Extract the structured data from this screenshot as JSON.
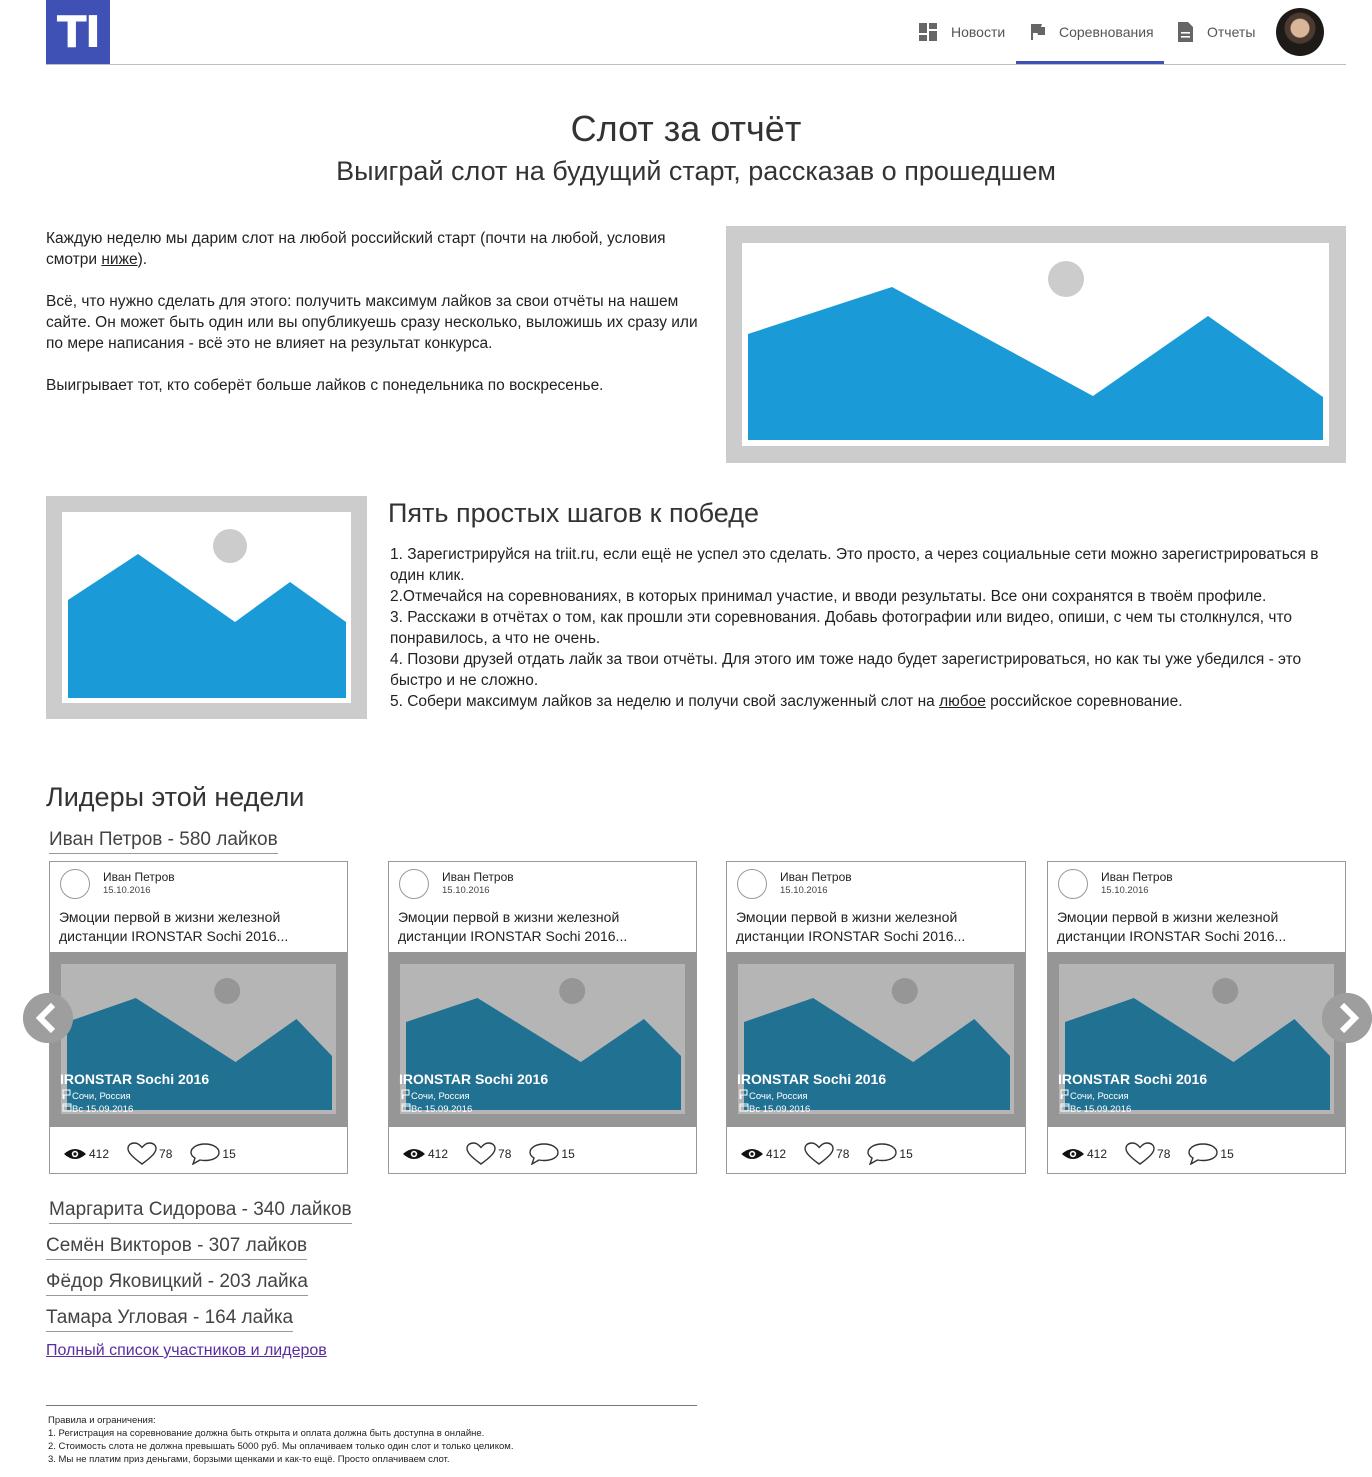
{
  "header": {
    "logo_text": "TI",
    "nav": [
      {
        "label": "Новости",
        "icon": "dashboard-icon"
      },
      {
        "label": "Соревнования",
        "icon": "flag-icon",
        "active": true
      },
      {
        "label": "Отчеты",
        "icon": "document-icon"
      }
    ],
    "accent_color": "#3f51b5"
  },
  "hero": {
    "title": "Слот за отчёт",
    "subtitle": "Выиграй слот на будущий старт, рассказав о прошедшем"
  },
  "intro": {
    "p1_before": "Каждую неделю мы дарим слот на любой российский старт (почти на любой, условия смотри ",
    "p1_link": "ниже",
    "p1_after": ").",
    "p2": "Всё, что нужно сделать для этого: получить максимум лайков за свои отчёты на нашем сайте. Он может быть один или вы опубликуешь сразу несколько, выложишь их сразу или по мере написания - всё это не влияет на результат конкурса.",
    "p3": "Выигрывает тот, кто соберёт больше лайков с понедельника по воскресенье."
  },
  "steps": {
    "title": "Пять простых шагов к победе",
    "items": [
      "1. Зарегистрируйся на triit.ru, если ещё не успел это сделать. Это просто, а через социальные сети можно зарегистрироваться в один клик.",
      "2.Отмечайся на соревнованиях, в которых принимал участие, и вводи результаты. Все они сохранятся в твоём профиле.",
      "3. Расскажи в отчётах о том, как прошли эти соревнования. Добавь фотографии или видео, опиши, с чем ты столкнулся, что понравилось, а что не очень.",
      "4. Позови друзей отдать лайк за твои отчёты. Для этого им тоже надо будет зарегистрироваться, но как ты уже убедился - это быстро и не сложно."
    ],
    "item5_before": "5. Собери максимум лайков за неделю и получи свой заслуженный слот на ",
    "item5_link": "любое",
    "item5_after": " российское соревнование."
  },
  "leaders": {
    "title": "Лидеры этой недели",
    "top": "Иван Петров - 580 лайков",
    "others": [
      "Маргарита Сидорова - 340 лайков",
      "Семён Викторов - 307 лайков",
      "Фёдор Яковицкий - 203 лайка",
      "Тамара Угловая - 164 лайка"
    ],
    "full_list_link": "Полный список участников и лидеров"
  },
  "cards": [
    {
      "author": "Иван Петров",
      "date": "15.10.2016",
      "excerpt": "Эмоции первой в жизни железной дистанции IRONSTAR Sochi 2016...",
      "event": "IRONSTAR Sochi 2016",
      "location": "Сочи, Россия",
      "event_date": "Вс 15.09.2016",
      "views": "412",
      "likes": "78",
      "comments": "15"
    },
    {
      "author": "Иван Петров",
      "date": "15.10.2016",
      "excerpt": "Эмоции первой в жизни железной дистанции IRONSTAR Sochi 2016...",
      "event": "IRONSTAR Sochi 2016",
      "location": "Сочи, Россия",
      "event_date": "Вс 15.09.2016",
      "views": "412",
      "likes": "78",
      "comments": "15"
    },
    {
      "author": "Иван Петров",
      "date": "15.10.2016",
      "excerpt": "Эмоции первой в жизни железной дистанции IRONSTAR Sochi 2016...",
      "event": "IRONSTAR Sochi 2016",
      "location": "Сочи, Россия",
      "event_date": "Вс 15.09.2016",
      "views": "412",
      "likes": "78",
      "comments": "15"
    },
    {
      "author": "Иван Петров",
      "date": "15.10.2016",
      "excerpt": "Эмоции первой в жизни железной дистанции IRONSTAR Sochi 2016...",
      "event": "IRONSTAR Sochi 2016",
      "location": "Сочи, Россия",
      "event_date": "Вс 15.09.2016",
      "views": "412",
      "likes": "78",
      "comments": "15"
    }
  ],
  "rules": {
    "title": "Правила и ограничения:",
    "items": [
      "1. Регистрация на соревнование должна быть открыта и оплата должна быть доступна в онлайне.",
      "2. Стоимость слота не должна превышать 5000 руб. Мы оплачиваем только один слот и только целиком.",
      "3. Мы не платим приз деньгами, борзыми щенками и как-то ещё. Просто оплачиваем слот."
    ]
  },
  "colors": {
    "placeholder_blue": "#1a9bd7",
    "placeholder_gray": "#cccccc",
    "card_overlay_blue": "#217193"
  }
}
